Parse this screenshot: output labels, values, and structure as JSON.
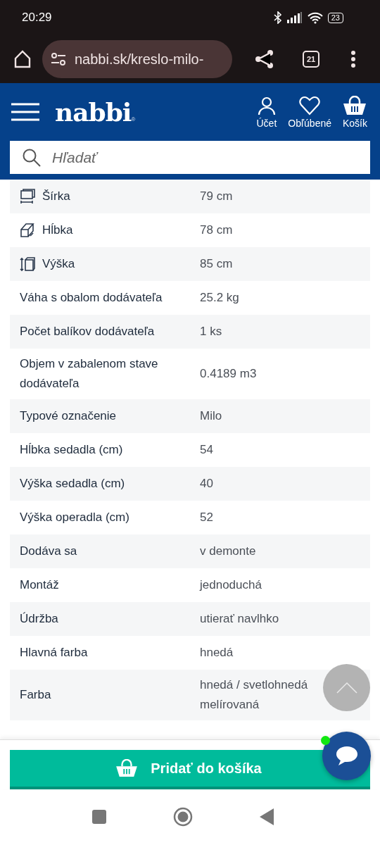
{
  "status_bar": {
    "time": "20:29",
    "battery": "23"
  },
  "browser": {
    "url": "nabbi.sk/kreslo-milo-",
    "tabs_count": "21"
  },
  "header": {
    "logo": {
      "text": "nabbi",
      "mark": "®"
    },
    "actions": [
      {
        "kind": "account",
        "label": "Účet"
      },
      {
        "kind": "favorites",
        "label": "Obľúbené"
      },
      {
        "kind": "cart",
        "label": "Košík"
      }
    ]
  },
  "search": {
    "placeholder": "Hľadať"
  },
  "specs": [
    {
      "kind": "width",
      "label": "Šírka",
      "value": "79 cm"
    },
    {
      "kind": "depth",
      "label": "Hĺbka",
      "value": "78 cm"
    },
    {
      "kind": "height",
      "label": "Výška",
      "value": "85 cm"
    },
    {
      "kind": "plain",
      "label": "Váha s obalom dodávateľa",
      "value": "25.2 kg"
    },
    {
      "kind": "plain",
      "label": "Počet balíkov dodávateľa",
      "value": "1 ks"
    },
    {
      "kind": "plain",
      "label": "Objem v zabalenom stave dodávateľa",
      "value": "0.4189 m3"
    },
    {
      "kind": "plain",
      "label": "Typové označenie",
      "value": "Milo"
    },
    {
      "kind": "plain",
      "label": "Hĺbka sedadla (cm)",
      "value": "54"
    },
    {
      "kind": "plain",
      "label": "Výška sedadla (cm)",
      "value": "40"
    },
    {
      "kind": "plain",
      "label": "Výška operadla (cm)",
      "value": "52"
    },
    {
      "kind": "plain",
      "label": "Dodáva sa",
      "value": "v demonte"
    },
    {
      "kind": "plain",
      "label": "Montáž",
      "value": "jednoduchá"
    },
    {
      "kind": "plain",
      "label": "Údržba",
      "value": "utierať navlhko"
    },
    {
      "kind": "plain",
      "label": "Hlavná farba",
      "value": "hnedá"
    },
    {
      "kind": "plain",
      "label": "Farba",
      "value": "hnedá / svetlohnedá melírovaná"
    }
  ],
  "add_to_cart": {
    "label": "Pridať do košíka"
  },
  "chat": {
    "online": true
  }
}
